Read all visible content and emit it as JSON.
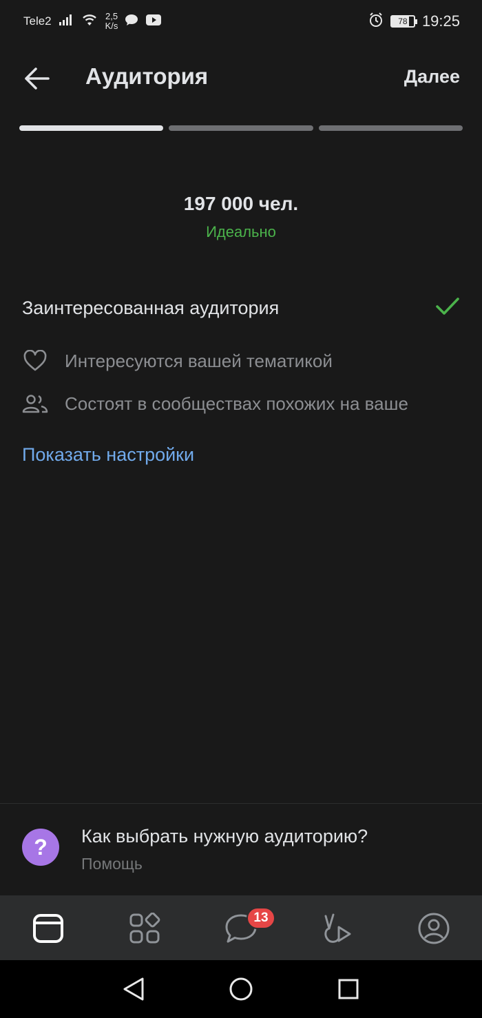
{
  "status_bar": {
    "carrier": "Tele2",
    "speed_value": "2,5",
    "speed_unit": "K/s",
    "battery": "78",
    "time": "19:25"
  },
  "header": {
    "title": "Аудитория",
    "next_label": "Далее",
    "back_icon": "arrow-left-icon"
  },
  "progress": {
    "steps_total": 3,
    "current_step": 1
  },
  "reach": {
    "count": "197 000 чел.",
    "quality": "Идеально",
    "quality_color": "#4bb34b"
  },
  "audience": {
    "title": "Заинтересованная аудитория",
    "items": [
      {
        "icon": "heart-icon",
        "label": "Интересуются вашей тематикой"
      },
      {
        "icon": "users-icon",
        "label": "Состоят в сообществах похожих на ваше"
      }
    ],
    "show_settings": "Показать настройки"
  },
  "help": {
    "title": "Как выбрать нужную аудиторию?",
    "subtitle": "Помощь",
    "icon_color": "#a776e6"
  },
  "tabbar": {
    "messages_badge": "13",
    "tabs": [
      "feed-icon",
      "services-icon",
      "messages-icon",
      "clips-icon",
      "profile-icon"
    ]
  },
  "colors": {
    "background": "#191919",
    "accent_link": "#71aaeb",
    "badge": "#e64646"
  }
}
